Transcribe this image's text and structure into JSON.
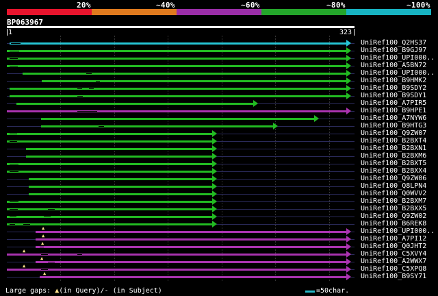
{
  "header": {
    "pct_labels": [
      "20%",
      "~40%",
      "~60%",
      "~80%",
      "~100%"
    ],
    "identity_colors": [
      "#e8142d",
      "#e07a1e",
      "#9b2ea8",
      "#24a62b",
      "#17b3c2"
    ],
    "query_id": "BP063967",
    "ruler_start": "1",
    "ruler_end": "323"
  },
  "colors": {
    "cyan": "#26c6d6",
    "green": "#22bb22",
    "purple": "#aa33b0"
  },
  "hits": [
    {
      "label": "UniRef100_Q2HS37",
      "color": "cyan"
    },
    {
      "label": "UniRef100_B9GJ97",
      "color": "green"
    },
    {
      "label": "UniRef100_UPI000..",
      "color": "green"
    },
    {
      "label": "UniRef100_A5BN72",
      "color": "green"
    },
    {
      "label": "UniRef100_UPI000..",
      "color": "green"
    },
    {
      "label": "UniRef100_B9HMK2",
      "color": "green"
    },
    {
      "label": "UniRef100_B9SDY2",
      "color": "green"
    },
    {
      "label": "UniRef100_B9SDY1",
      "color": "green"
    },
    {
      "label": "UniRef100_A7PIR5",
      "color": "green"
    },
    {
      "label": "UniRef100_B9HPE1",
      "color": "purple"
    },
    {
      "label": "UniRef100_A7NYW6",
      "color": "green"
    },
    {
      "label": "UniRef100_B9HTG3",
      "color": "green"
    },
    {
      "label": "UniRef100_Q9ZW07",
      "color": "green"
    },
    {
      "label": "UniRef100_B2BXT4",
      "color": "green"
    },
    {
      "label": "UniRef100_B2BXN1",
      "color": "green"
    },
    {
      "label": "UniRef100_B2BXM6",
      "color": "green"
    },
    {
      "label": "UniRef100_B2BXT5",
      "color": "green"
    },
    {
      "label": "UniRef100_B2BXX4",
      "color": "green"
    },
    {
      "label": "UniRef100_Q9ZW06",
      "color": "green"
    },
    {
      "label": "UniRef100_Q8LPN4",
      "color": "green"
    },
    {
      "label": "UniRef100_Q0WVV2",
      "color": "green"
    },
    {
      "label": "UniRef100_B2BXM7",
      "color": "green"
    },
    {
      "label": "UniRef100_B2BXX5",
      "color": "green"
    },
    {
      "label": "UniRef100_Q9ZW02",
      "color": "green"
    },
    {
      "label": "UniRef100_B6REK8",
      "color": "green"
    },
    {
      "label": "UniRef100_UPI000..",
      "color": "purple"
    },
    {
      "label": "UniRef100_A7PI12",
      "color": "purple"
    },
    {
      "label": "UniRef100_Q0JHT2",
      "color": "purple"
    },
    {
      "label": "UniRef100_C5XVY4",
      "color": "purple"
    },
    {
      "label": "UniRef100_A2WWX7",
      "color": "purple"
    },
    {
      "label": "UniRef100_C5XPQ8",
      "color": "purple"
    },
    {
      "label": "UniRef100_B9SY71",
      "color": "purple"
    }
  ],
  "legend": {
    "gaps_text": "Large gaps: ",
    "query_mark": "▲",
    "in_query": "(in Query)/",
    "subject_mark": "-",
    "in_subject": " (in Subject)",
    "scale_text": "=50char."
  }
}
